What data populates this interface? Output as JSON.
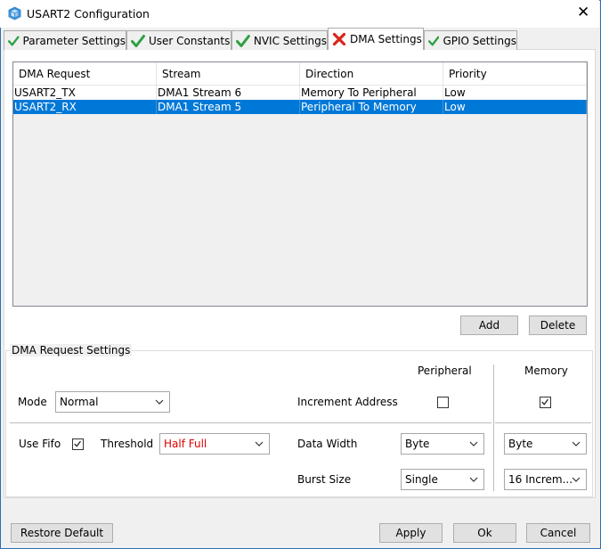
{
  "window": {
    "title": "USART2 Configuration",
    "close_glyph": "✕"
  },
  "tabs": [
    {
      "label": "Parameter Settings",
      "status_icon": "check-icon"
    },
    {
      "label": "User Constants",
      "status_icon": "check-icon"
    },
    {
      "label": "NVIC Settings",
      "status_icon": "check-icon"
    },
    {
      "label": "DMA Settings",
      "status_icon": "error-x-icon",
      "active": true
    },
    {
      "label": "GPIO Settings",
      "status_icon": "check-icon"
    }
  ],
  "dma_table": {
    "columns": [
      "DMA Request",
      "Stream",
      "Direction",
      "Priority"
    ],
    "rows": [
      [
        "USART2_TX",
        "DMA1 Stream 6",
        "Memory To Peripheral",
        "Low"
      ],
      [
        "USART2_RX",
        "DMA1 Stream 5",
        "Peripheral To Memory",
        "Low"
      ]
    ],
    "selected_row": 1
  },
  "table_buttons": {
    "add": "Add",
    "delete": "Delete"
  },
  "request_settings": {
    "group_title": "DMA Request Settings",
    "peripheral_header": "Peripheral",
    "memory_header": "Memory",
    "mode_label": "Mode",
    "mode_value": "Normal",
    "increment_address_label": "Increment Address",
    "peripheral_increment_checked": false,
    "memory_increment_checked": true,
    "use_fifo_label": "Use Fifo",
    "use_fifo_checked": true,
    "threshold_label": "Threshold",
    "threshold_value": "Half Full",
    "threshold_color": "#e00000",
    "data_width_label": "Data Width",
    "peripheral_data_width": "Byte",
    "memory_data_width": "Byte",
    "burst_size_label": "Burst Size",
    "peripheral_burst_size": "Single",
    "memory_burst_size": "16 Increm..."
  },
  "footer": {
    "restore_default": "Restore Default",
    "apply": "Apply",
    "ok": "Ok",
    "cancel": "Cancel"
  },
  "colors": {
    "selection": "#0078d7",
    "check_green": "#2ea043",
    "error_red": "#d9261c",
    "window_border": "#2b6fb5"
  }
}
